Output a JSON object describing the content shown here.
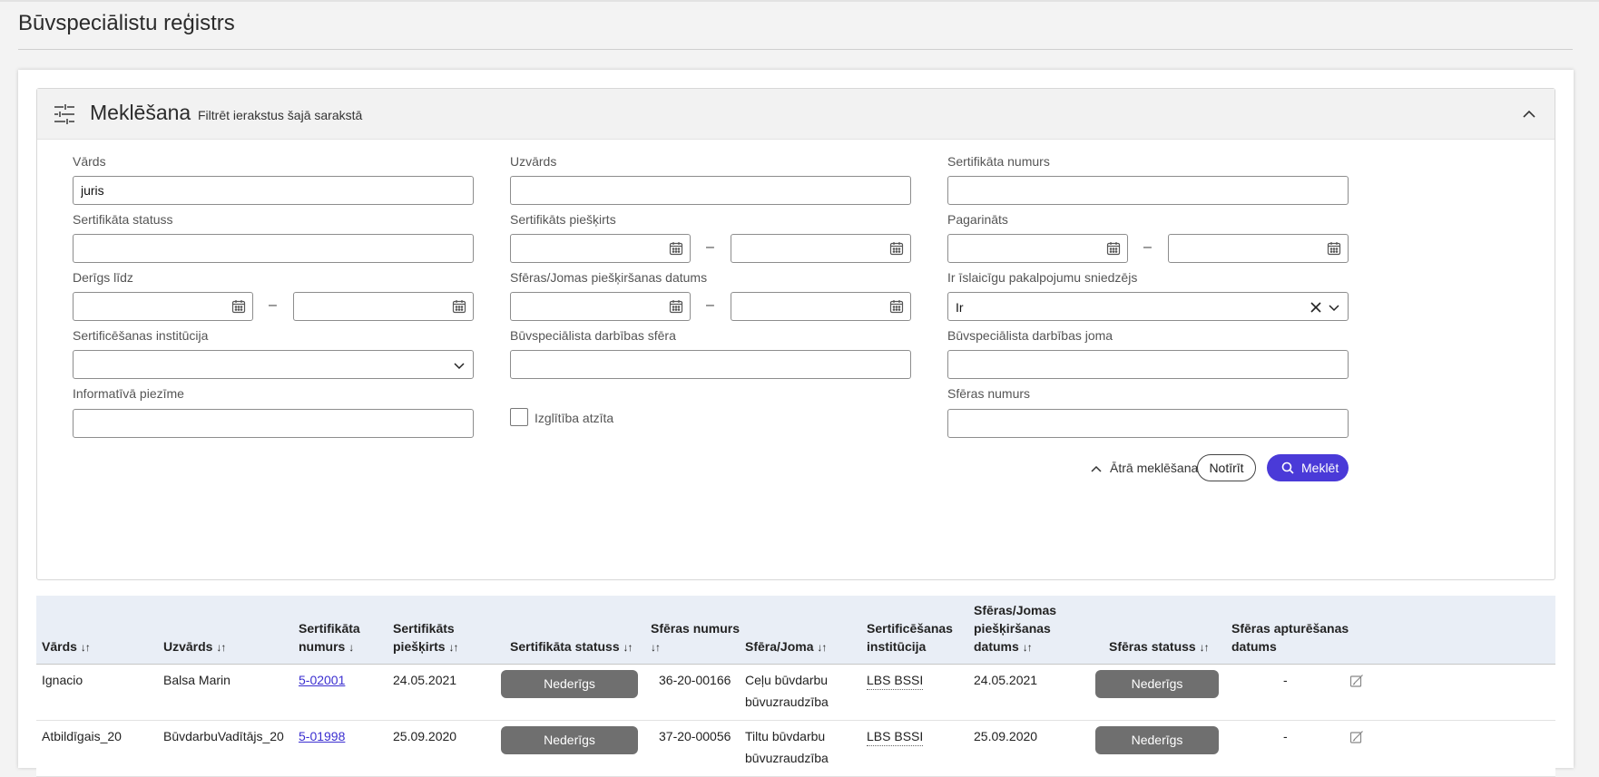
{
  "page": {
    "title": "Būvspeciālistu reģistrs"
  },
  "search": {
    "title": "Meklēšana",
    "subtitle": "Filtrēt ierakstus šajā sarakstā",
    "fields": {
      "vards": {
        "label": "Vārds",
        "value": "juris"
      },
      "uzvards": {
        "label": "Uzvārds",
        "value": ""
      },
      "sert_numurs": {
        "label": "Sertifikāta numurs",
        "value": ""
      },
      "sert_statuss": {
        "label": "Sertifikāta statuss",
        "value": ""
      },
      "sert_pieskirts": {
        "label": "Sertifikāts piešķirts"
      },
      "pagarinats": {
        "label": "Pagarināts"
      },
      "derigs_lidz": {
        "label": "Derīgs līdz"
      },
      "sferas_datums": {
        "label": "Sfēras/Jomas piešķiršanas datums"
      },
      "islaicigu": {
        "label": "Ir īslaicīgu pakalpojumu sniedzējs",
        "value": "Ir"
      },
      "institucija": {
        "label": "Sertificēšanas institūcija",
        "value": ""
      },
      "darbibas_sfera": {
        "label": "Būvspeciālista darbības sfēra",
        "value": ""
      },
      "darbibas_joma": {
        "label": "Būvspeciālista darbības joma",
        "value": ""
      },
      "piezime": {
        "label": "Informatīvā piezīme",
        "value": ""
      },
      "izglitiba": {
        "label": "Izglītība atzīta",
        "checked": false
      },
      "sferas_numurs": {
        "label": "Sfēras numurs",
        "value": ""
      }
    },
    "dash": "–",
    "quick_search_label": "Ātrā meklēšana",
    "clear_label": "Notīrīt",
    "search_label": "Meklēt"
  },
  "table": {
    "sort_both": "↓↑",
    "sort_down": "↓",
    "columns": {
      "vards": "Vārds",
      "uzvards": "Uzvārds",
      "sert_numurs_1": "Sertifikāta",
      "sert_numurs_2": "numurs",
      "sert_pieskirts_1": "Sertifikāts",
      "sert_pieskirts_2": "piešķirts",
      "sert_statuss": "Sertifikāta statuss",
      "sferas_numurs_1": "Sfēras numurs",
      "sfera_joma": "Sfēra/Joma",
      "institucija_1": "Sertificēšanas",
      "institucija_2": "institūcija",
      "sferas_datums_1": "Sfēras/Jomas",
      "sferas_datums_2": "piešķiršanas",
      "sferas_datums_3": "datums",
      "sferas_statuss": "Sfēras statuss",
      "apturesanas_1": "Sfēras apturēšanas",
      "apturesanas_2": "datums"
    },
    "rows": [
      {
        "vards": "Ignacio",
        "uzvards": "Balsa Marin",
        "sert_numurs": "5-02001",
        "sert_pieskirts": "24.05.2021",
        "sert_statuss": "Nederīgs",
        "sferas_numurs": "36-20-00166",
        "sfera_1": "Ceļu būvdarbu",
        "sfera_2": "būvuzraudzība",
        "institucija": "LBS BSSI",
        "sferas_datums": "24.05.2021",
        "sferas_statuss": "Nederīgs",
        "apturesanas": "-"
      },
      {
        "vards": "Atbildīgais_20",
        "uzvards": "BūvdarbuVadītājs_20",
        "sert_numurs": "5-01998",
        "sert_pieskirts": "25.09.2020",
        "sert_statuss": "Nederīgs",
        "sferas_numurs": "37-20-00056",
        "sfera_1": "Tiltu būvdarbu",
        "sfera_2": "būvuzraudzība",
        "institucija": "LBS BSSI",
        "sferas_datums": "25.09.2020",
        "sferas_statuss": "Nederīgs",
        "apturesanas": "-"
      }
    ]
  },
  "colors": {
    "primary": "#4a3ad8",
    "status_pill": "#6f6f6f",
    "table_header": "#e9eef6"
  }
}
